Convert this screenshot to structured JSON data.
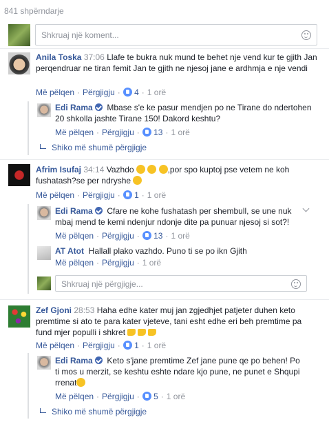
{
  "shares": "841 shpërndarje",
  "comment_box": {
    "placeholder": "Shkruaj një koment..."
  },
  "reply_box": {
    "placeholder": "Shkruaj një përgjigje..."
  },
  "actions": {
    "like": "Më pëlqen",
    "reply": "Përgjigju"
  },
  "more_replies": "Shiko më shumë përgjigje",
  "comments": [
    {
      "author": "Anila Toska",
      "time": "37:06",
      "text": "Llafe te bukra nuk mund te behet nje vend kur te gjith Jan perqendruar ne tiran femit Jan te gjith ne njesoj jane e ardhmja e nje vendi",
      "likes": "4",
      "age": "1 orë"
    },
    {
      "author": "Edi Rama",
      "verified": true,
      "text": "Mbase s'e ke pasur mendjen po ne Tirane do ndertohen 20 shkolla jashte Tirane 150! Dakord keshtu?",
      "likes": "13",
      "age": "1 orë"
    },
    {
      "author": "Afrim Isufaj",
      "time": "34:14",
      "text_a": "Vazhdo",
      "text_b": ",por spo kuptoj pse vetem ne koh fushatash?se per ndryshe",
      "likes": "1",
      "age": "1 orë"
    },
    {
      "author": "Edi Rama",
      "verified": true,
      "text": "Cfare ne kohe fushatash per shembull, se une nuk mbaj mend te kemi ndenjur ndonje dite pa punuar njesoj si sot?!",
      "likes": "13",
      "age": "1 orë"
    },
    {
      "author": "AT Atot",
      "text": "Hallall plako vazhdo. Puno ti se po ikn Gjith",
      "age": "1 orë"
    },
    {
      "author": "Zef Gjoni",
      "time": "28:53",
      "text": "Haha edhe kater muj jan zgjedhjet patjeter duhen keto premtime si ato te para kater vjeteve, tani esht edhe eri beh premtime pa fund mjer populli i shkret",
      "likes": "1",
      "age": "1 orë"
    },
    {
      "author": "Edi Rama",
      "verified": true,
      "text": "Keto s'jane premtime Zef jane pune qe po behen! Po ti mos u merzit, se keshtu eshte ndare kjo pune, ne punet e Shqupi rrenat",
      "likes": "5",
      "age": "1 orë"
    }
  ],
  "colors": {
    "link": "#365899",
    "meta": "#90949c",
    "like_badge": "#5890ff",
    "verified": "#4267b2"
  }
}
